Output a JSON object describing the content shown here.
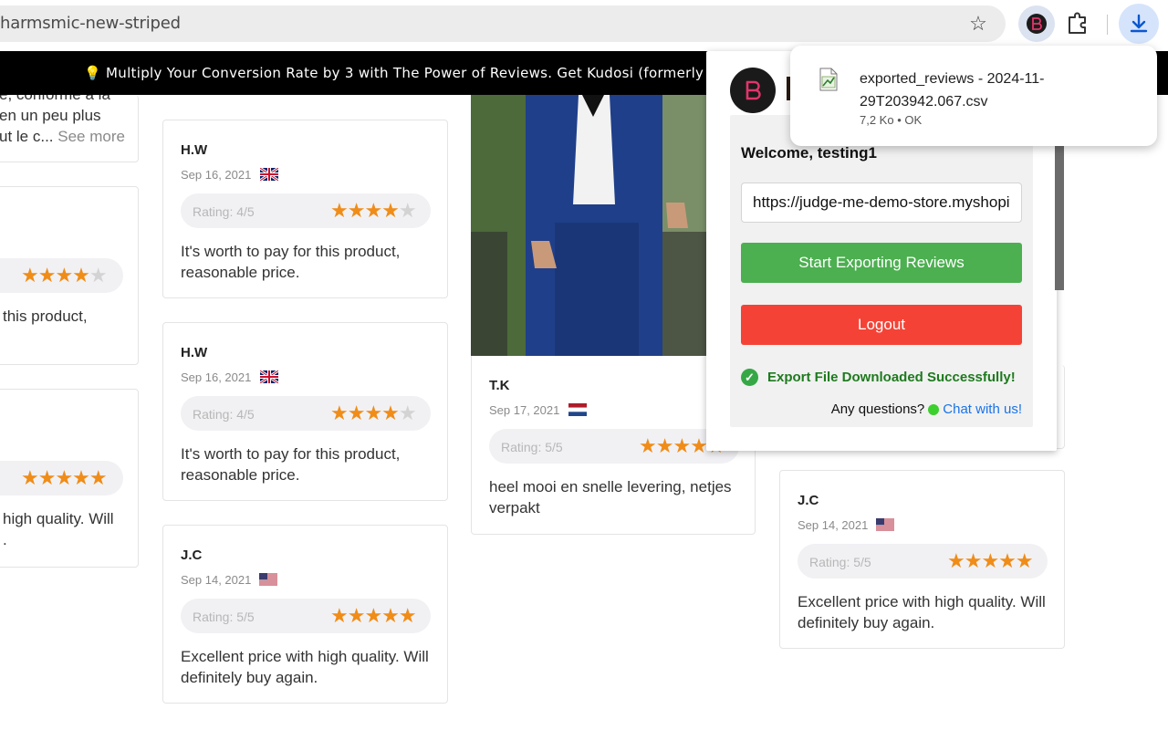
{
  "browser": {
    "url": "harmsmic-new-striped",
    "icons": [
      "star-icon",
      "extension-logo-icon",
      "puzzle-icon",
      "download-icon"
    ]
  },
  "announcement": {
    "text": "💡 Multiply Your Conversion Rate by 3 with The Power of Reviews. Get Kudosi (formerly"
  },
  "reviews": {
    "left_col": {
      "partial1": "é, conforme à la",
      "partial2": "en un peu plus",
      "partial3": "ut le c...",
      "see_more": "See more",
      "partial4": "this product,",
      "partial5": "high quality. Will",
      "partial6": "."
    },
    "cards": [
      {
        "author": "H.W",
        "date": "Sep 16, 2021",
        "flag": "uk",
        "rating_label": "Rating: 4/5",
        "rating": 4,
        "text": "It's worth to pay for this product, reasonable price."
      },
      {
        "author": "H.W",
        "date": "Sep 16, 2021",
        "flag": "uk",
        "rating_label": "Rating: 4/5",
        "rating": 4,
        "text": "It's worth to pay for this product, reasonable price."
      },
      {
        "author": "J.C",
        "date": "Sep 14, 2021",
        "flag": "us",
        "rating_label": "Rating: 5/5",
        "rating": 5,
        "text": "Excellent price with high quality. Will definitely buy again."
      },
      {
        "author": "T.K",
        "date": "Sep 17, 2021",
        "flag": "nl",
        "rating_label": "Rating: 5/5",
        "rating": 5,
        "text": "heel mooi en snelle levering, netjes verpakt"
      },
      {
        "author": "J.C",
        "date": "Sep 14, 2021",
        "flag": "us",
        "rating_label": "Rating: 5/5",
        "rating": 5,
        "text": "Excellent price with high quality. Will definitely buy again."
      }
    ]
  },
  "popup": {
    "welcome": "Welcome, testing1",
    "store_url": "https://judge-me-demo-store.myshopif",
    "export_label": "Start Exporting Reviews",
    "logout_label": "Logout",
    "success": "Export File Downloaded Successfully!",
    "questions": "Any questions?",
    "chat_link": "Chat with us!",
    "colors": {
      "export": "#4caf50",
      "logout": "#f44336",
      "success": "#1e7a1e"
    }
  },
  "download": {
    "filename": "exported_reviews - 2024-11-29T203942.067.csv",
    "meta": "7,2 Ko • OK"
  }
}
